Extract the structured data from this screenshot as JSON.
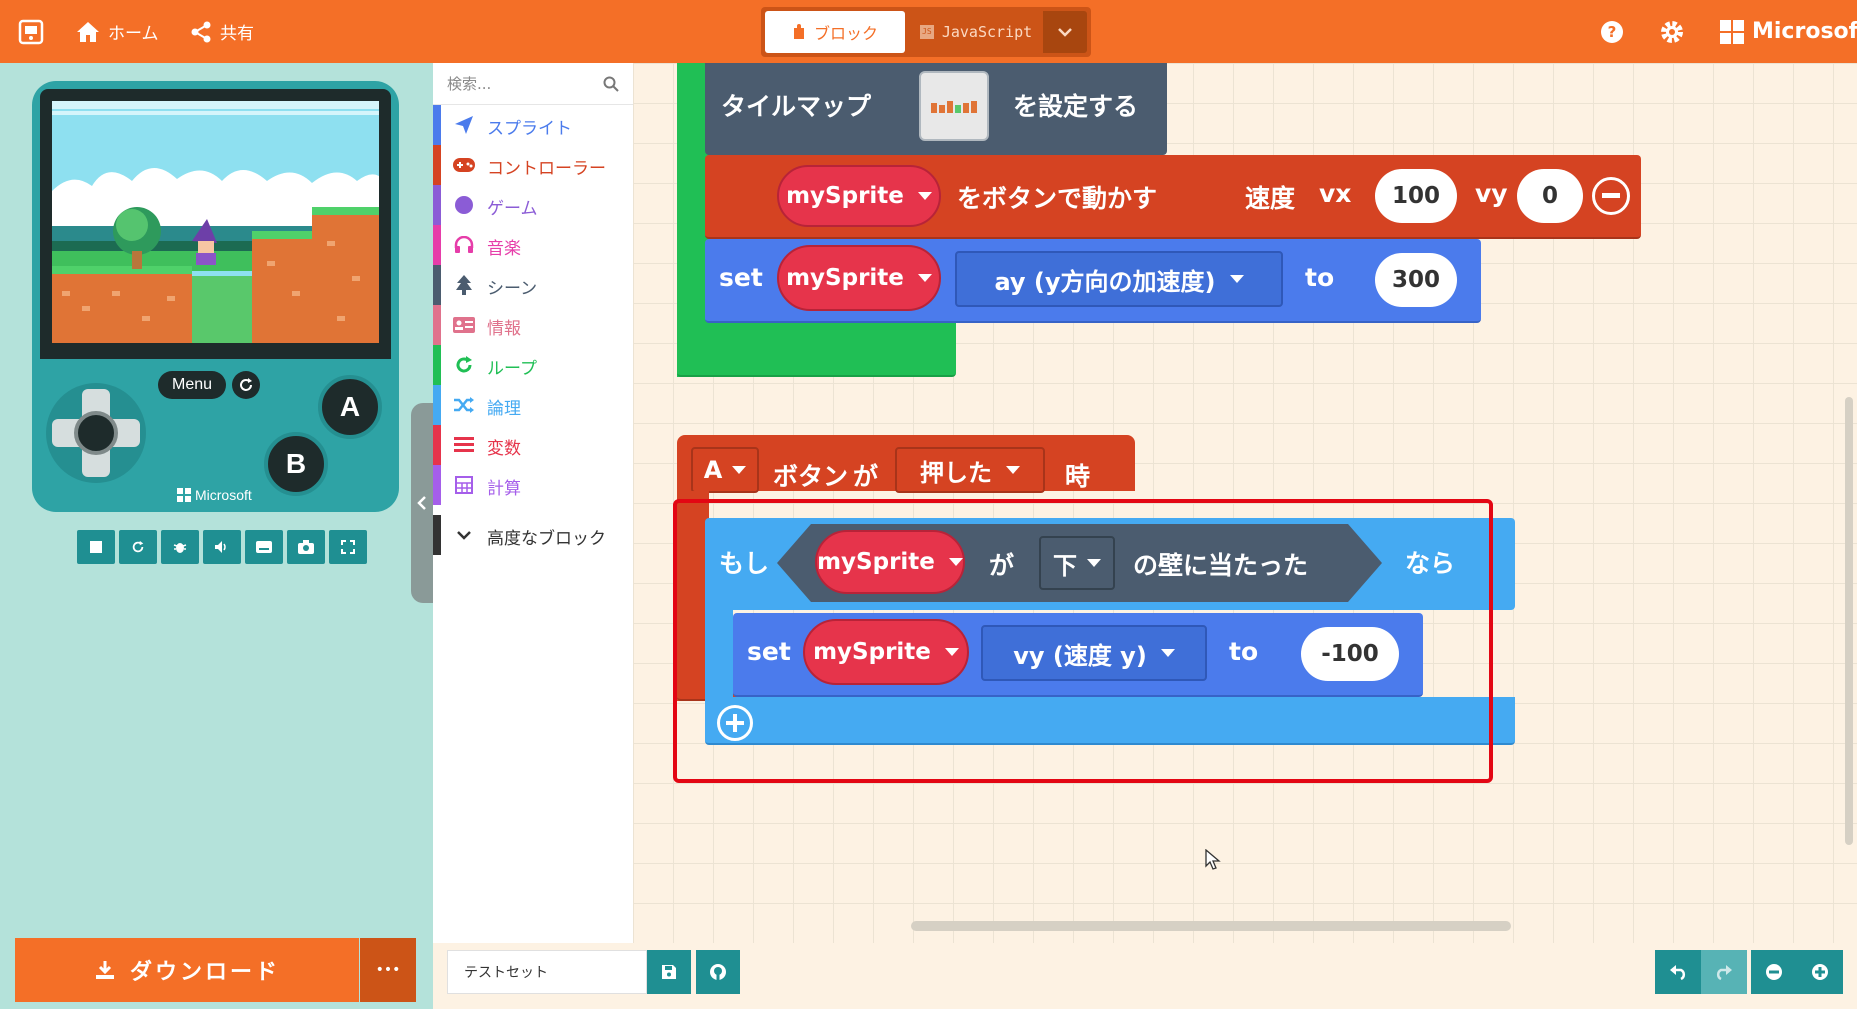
{
  "topbar": {
    "home_label": "ホーム",
    "share_label": "共有",
    "blocks_tab": "ブロック",
    "js_tab": "JavaScript",
    "brand": "Microsoft"
  },
  "simulator": {
    "menu_label": "Menu",
    "a_label": "A",
    "b_label": "B",
    "brand": "Microsoft"
  },
  "download": {
    "label": "ダウンロード",
    "more": "•••"
  },
  "toolbox": {
    "search_placeholder": "検索...",
    "categories": [
      {
        "label": "スプライト",
        "color": "#4b7bec"
      },
      {
        "label": "コントローラー",
        "color": "#d54322"
      },
      {
        "label": "ゲーム",
        "color": "#8b5cd6"
      },
      {
        "label": "音楽",
        "color": "#e63da9"
      },
      {
        "label": "シーン",
        "color": "#4b5c6f"
      },
      {
        "label": "情報",
        "color": "#e0728c"
      },
      {
        "label": "ループ",
        "color": "#20bf55"
      },
      {
        "label": "論理",
        "color": "#45aaf2"
      },
      {
        "label": "変数",
        "color": "#e6344b"
      },
      {
        "label": "計算",
        "color": "#a55eea"
      }
    ],
    "advanced_label": "高度なブロック"
  },
  "workspace": {
    "tilemap": {
      "label": "タイルマップ",
      "suffix": "を設定する"
    },
    "move": {
      "sprite": "mySprite",
      "text": "をボタンで動かす",
      "speed": "速度",
      "vx_label": "vx",
      "vx": "100",
      "vy_label": "vy",
      "vy": "0"
    },
    "set1": {
      "set": "set",
      "sprite": "mySprite",
      "prop": "ay (y方向の加速度)",
      "to": "to",
      "value": "300"
    },
    "event": {
      "button": "A",
      "ga": "ボタン",
      "ga2": "が",
      "action": "押した",
      "when": "時"
    },
    "if": {
      "moshi": "もし",
      "sprite": "mySprite",
      "ga": "が",
      "dir": "下",
      "text": "の壁に当たった",
      "nara": "なら"
    },
    "set2": {
      "set": "set",
      "sprite": "mySprite",
      "prop": "vy (速度 y)",
      "to": "to",
      "value": "-100"
    }
  },
  "footer": {
    "project_name": "テストセット"
  },
  "colors": {
    "accent": "#f46f27",
    "highlight": "#e30613"
  }
}
